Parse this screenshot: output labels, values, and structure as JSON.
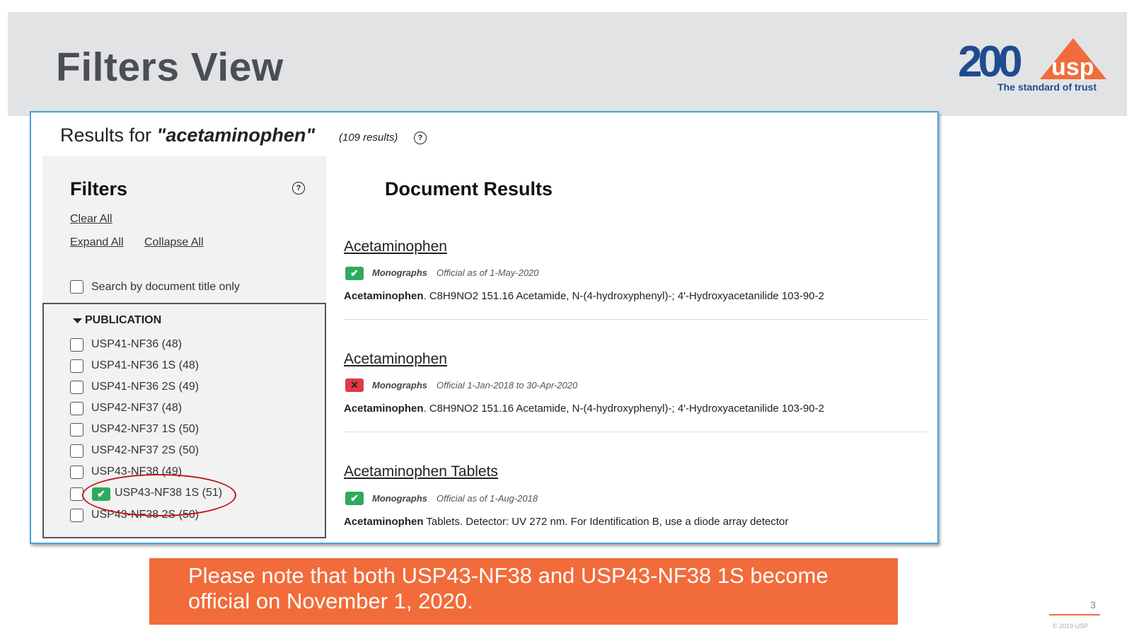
{
  "slide": {
    "title": "Filters View",
    "logo": {
      "mark": "200",
      "brand": "usp",
      "tagline": "The standard of trust"
    },
    "page_number": "3",
    "copyright": "© 2019 USP"
  },
  "search": {
    "results_prefix": "Results for ",
    "query": "\"acetaminophen\"",
    "count": "(109 results)"
  },
  "filters": {
    "title": "Filters",
    "clear_all": "Clear All",
    "expand_all": "Expand All",
    "collapse_all": "Collapse All",
    "title_only_label": "Search by document title only",
    "publication": {
      "title": "PUBLICATION",
      "items": [
        {
          "label": "USP41-NF36 (48)",
          "checked": false
        },
        {
          "label": "USP41-NF36 1S (48)",
          "checked": false
        },
        {
          "label": "USP41-NF36 2S (49)",
          "checked": false
        },
        {
          "label": "USP42-NF37 (48)",
          "checked": false
        },
        {
          "label": "USP42-NF37 1S (50)",
          "checked": false
        },
        {
          "label": "USP42-NF37 2S (50)",
          "checked": false
        },
        {
          "label": "USP43-NF38 (49)",
          "checked": false
        },
        {
          "label": "USP43-NF38 1S (51)",
          "checked": true
        },
        {
          "label": "USP43-NF38 2S (50)",
          "checked": false
        }
      ]
    }
  },
  "results": {
    "title": "Document Results",
    "items": [
      {
        "title": "Acetaminophen",
        "type": "Monographs",
        "status": "Official as of 1-May-2020",
        "official": true,
        "snippet_bold": "Acetaminophen",
        "snippet_rest": ". C8H9NO2 151.16 Acetamide, N-(4-hydroxyphenyl)-; 4'-Hydroxyacetanilide 103-90-2"
      },
      {
        "title": "Acetaminophen",
        "type": "Monographs",
        "status": "Official 1-Jan-2018 to 30-Apr-2020",
        "official": false,
        "snippet_bold": "Acetaminophen",
        "snippet_rest": ". C8H9NO2 151.16 Acetamide, N-(4-hydroxyphenyl)-; 4'-Hydroxyacetanilide 103-90-2"
      },
      {
        "title": "Acetaminophen Tablets",
        "type": "Monographs",
        "status": "Official as of 1-Aug-2018",
        "official": true,
        "snippet_bold": "Acetaminophen",
        "snippet_rest": " Tablets. Detector: UV 272 nm. For Identification B, use a diode array detector"
      }
    ]
  },
  "note": {
    "text": "Please note that both USP43-NF38 and USP43-NF38 1S become official on November 1, 2020."
  },
  "colors": {
    "accent_orange": "#f26b3a",
    "official_green": "#2eaa5e",
    "expired_red": "#e0394a",
    "highlight_red": "#c0161d",
    "frame_blue": "#4aa3d9"
  }
}
